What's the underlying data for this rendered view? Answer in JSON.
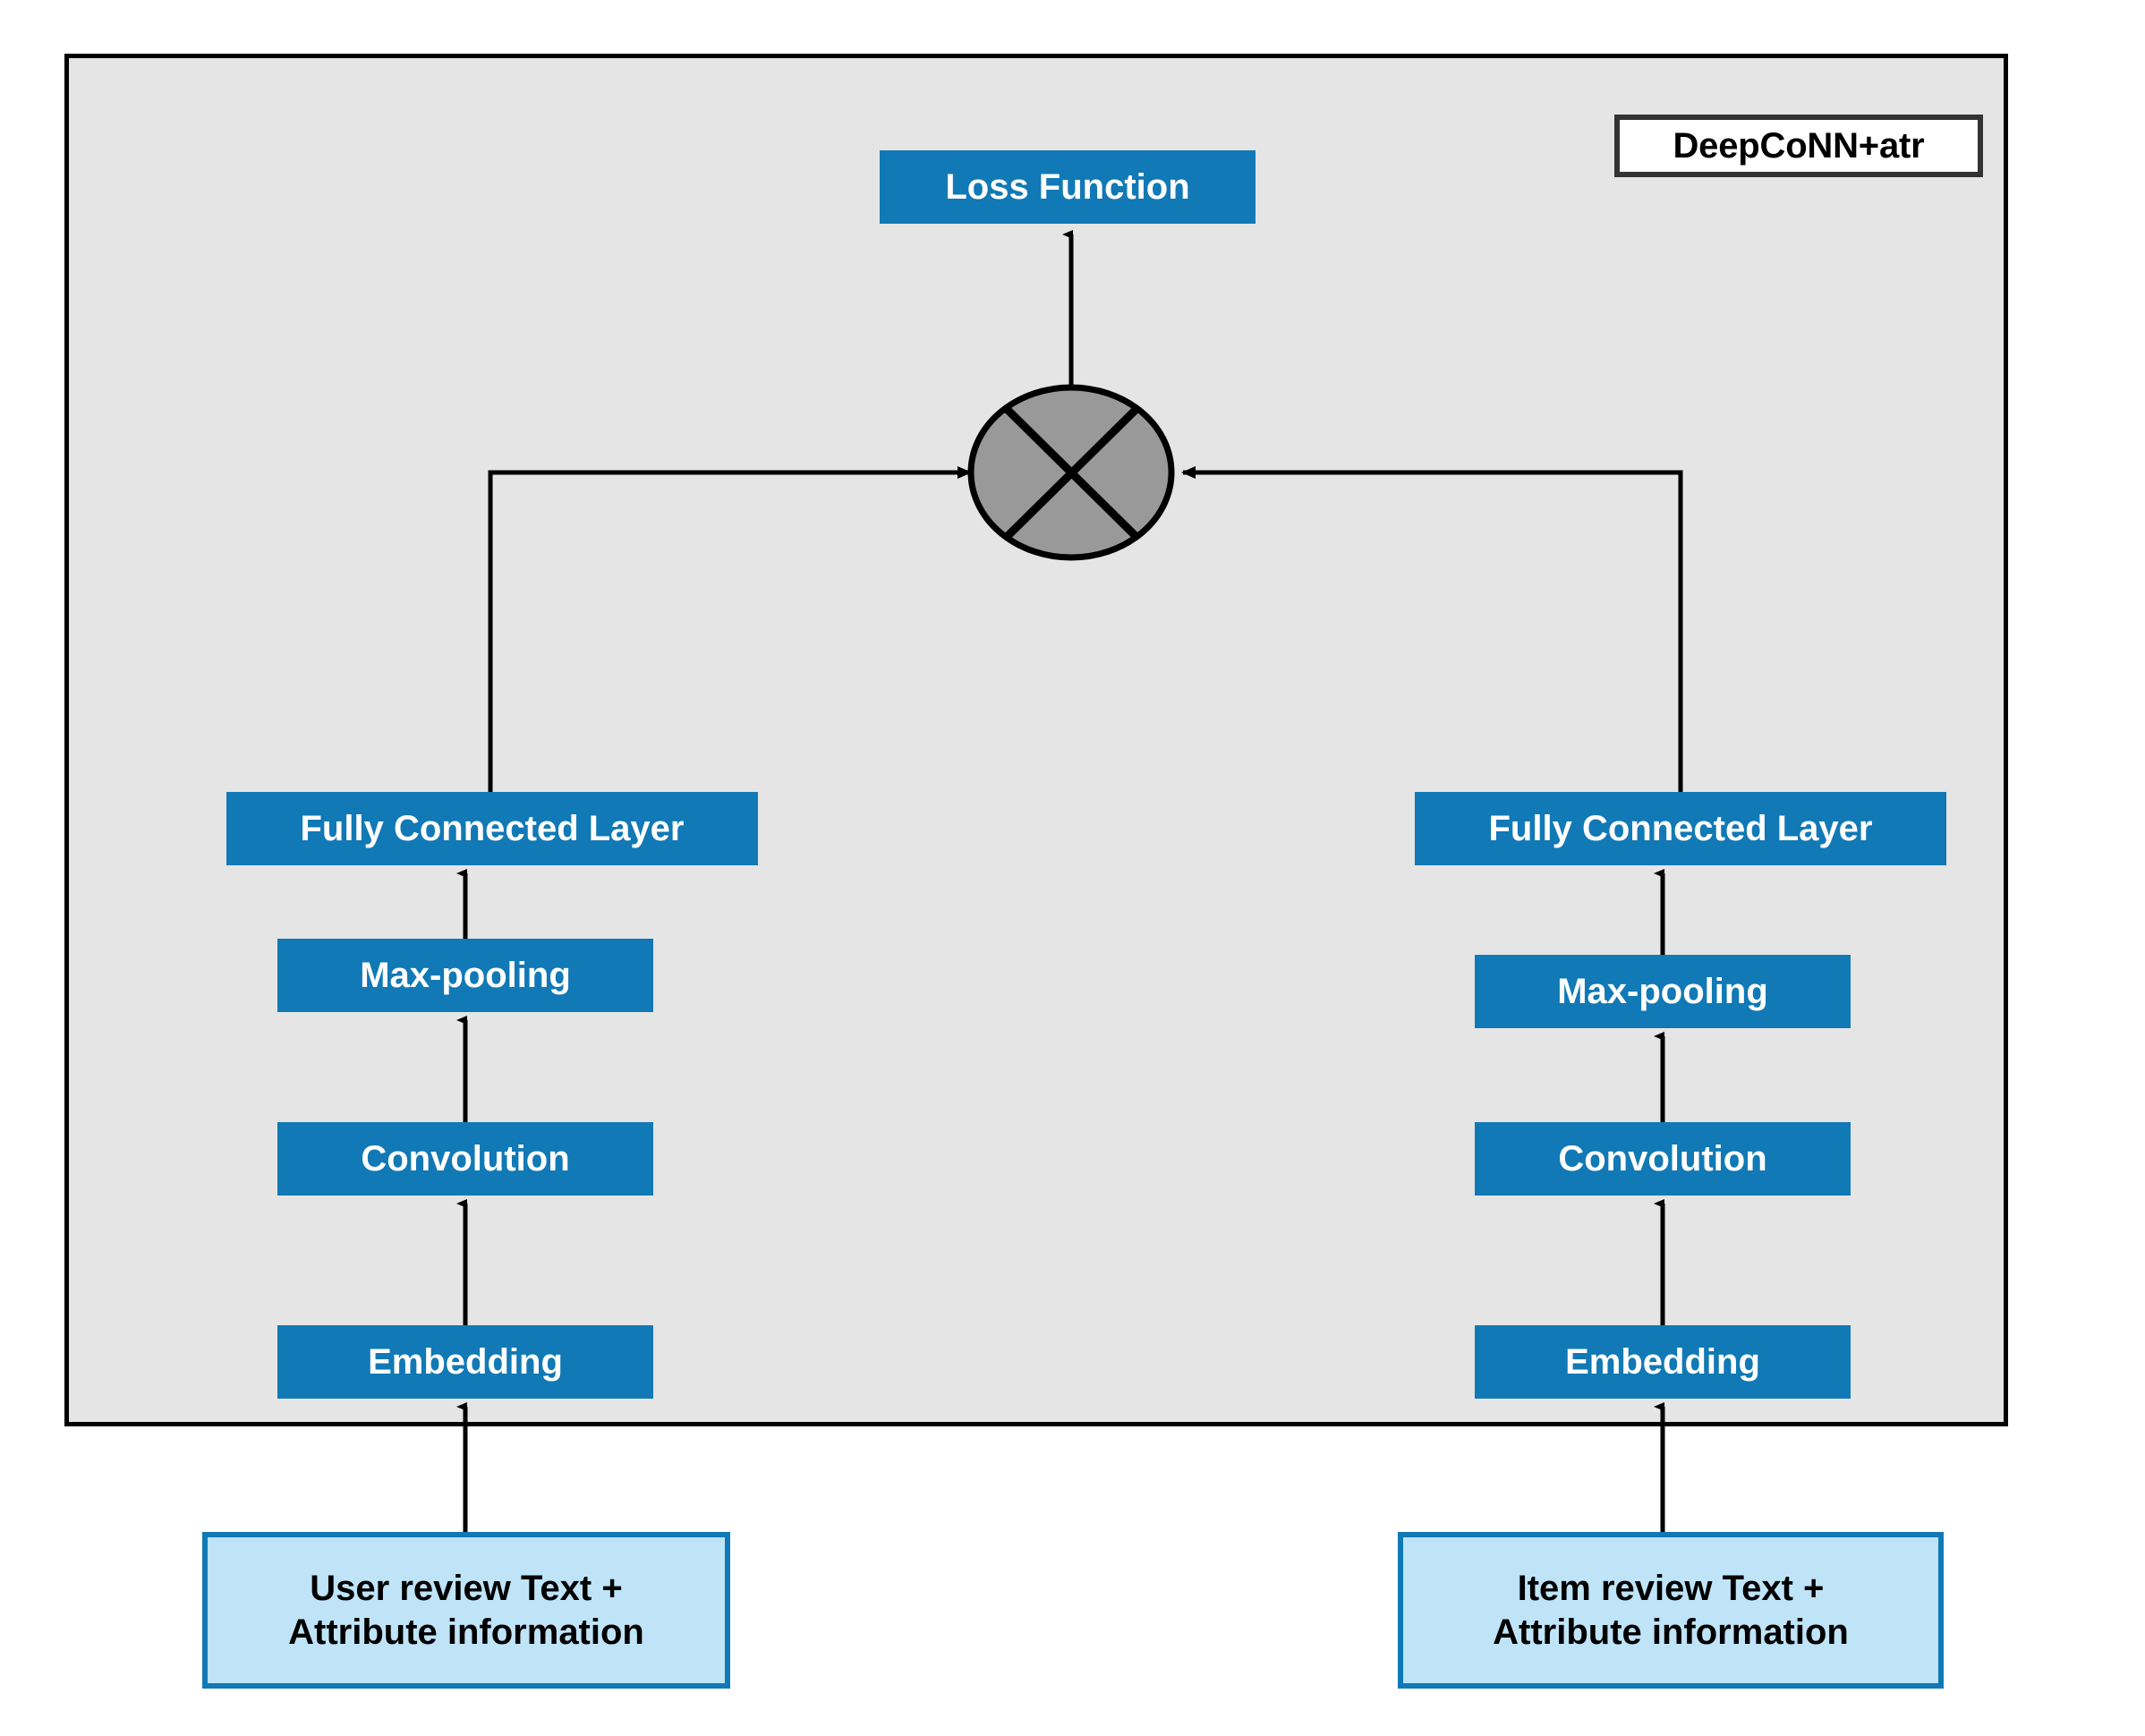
{
  "diagram": {
    "title": "DeepCoNN+atr",
    "output": {
      "label": "Loss Function"
    },
    "merge_node": {
      "operator": "element-wise-product"
    },
    "branches": [
      {
        "side": "left",
        "name": "user-branch",
        "input": "User review Text +\nAttribute information",
        "input_line1": "User review Text +",
        "input_line2": "Attribute information",
        "layers": [
          {
            "label": "Embedding"
          },
          {
            "label": "Convolution"
          },
          {
            "label": "Max-pooling"
          },
          {
            "label": "Fully Connected Layer"
          }
        ]
      },
      {
        "side": "right",
        "name": "item-branch",
        "input": "Item review Text +\nAttribute information",
        "input_line1": "Item review Text +",
        "input_line2": "Attribute information",
        "layers": [
          {
            "label": "Embedding"
          },
          {
            "label": "Convolution"
          },
          {
            "label": "Max-pooling"
          },
          {
            "label": "Fully Connected Layer"
          }
        ]
      }
    ],
    "colors": {
      "panel_background": "#e5e5e5",
      "panel_border": "#000000",
      "layer_fill": "#1179b5",
      "layer_text": "#ffffff",
      "input_fill": "#bfe3f7",
      "input_border": "#1179b5",
      "merge_node_fill": "#999999",
      "merge_node_stroke": "#000000",
      "legend_border": "#333333",
      "legend_fill": "#ffffff"
    }
  }
}
